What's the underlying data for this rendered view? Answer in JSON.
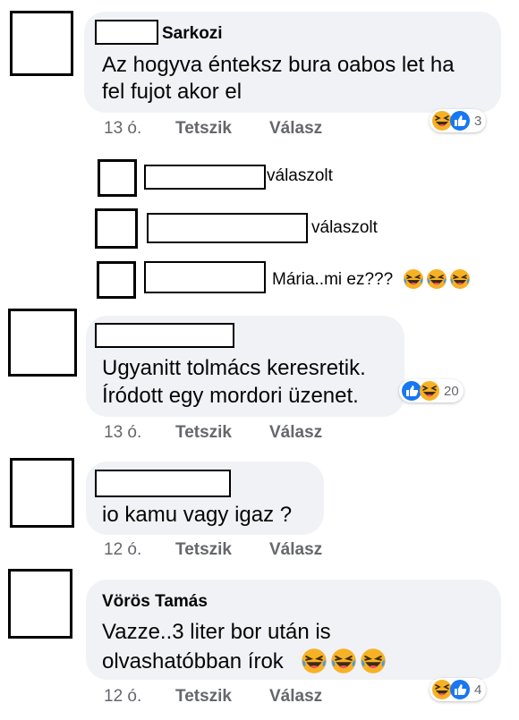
{
  "comments": [
    {
      "name": "Sarkozi",
      "lines": [
        "Az hogyva énteksz bura oabos let ha",
        "fel fujot akor el"
      ],
      "time": "13 ó.",
      "like": "Tetszik",
      "reply": "Válasz",
      "reaction_count": "3"
    },
    {
      "name": "",
      "lines": [
        "Ugyanitt tolmács keresretik.",
        "Íródott egy mordori üzenet."
      ],
      "time": "13 ó.",
      "like": "Tetszik",
      "reply": "Válasz",
      "reaction_count": "20"
    },
    {
      "name": "",
      "lines": [
        "io kamu vagy igaz ?"
      ],
      "time": "12 ó.",
      "like": "Tetszik",
      "reply": "Válasz"
    },
    {
      "name": "Vörös Tamás",
      "lines": [
        "Vazze..3 liter bor után is",
        "olvashatóbban írok"
      ],
      "time": "12 ó.",
      "like": "Tetszik",
      "reply": "Válasz",
      "reaction_count": "4"
    }
  ],
  "replies": [
    {
      "text": "válaszolt"
    },
    {
      "text": "válaszolt"
    },
    {
      "text": "Mária..mi ez???"
    }
  ],
  "icons": {
    "laugh": "laugh-emoji-icon",
    "like": "like-reaction-icon",
    "laugh_react": "haha-reaction-icon"
  },
  "colors": {
    "bubble": "#f0f2f5",
    "meta": "#65676b",
    "like_blue": "#1877f2",
    "emoji_yellow": "#f7b125"
  }
}
